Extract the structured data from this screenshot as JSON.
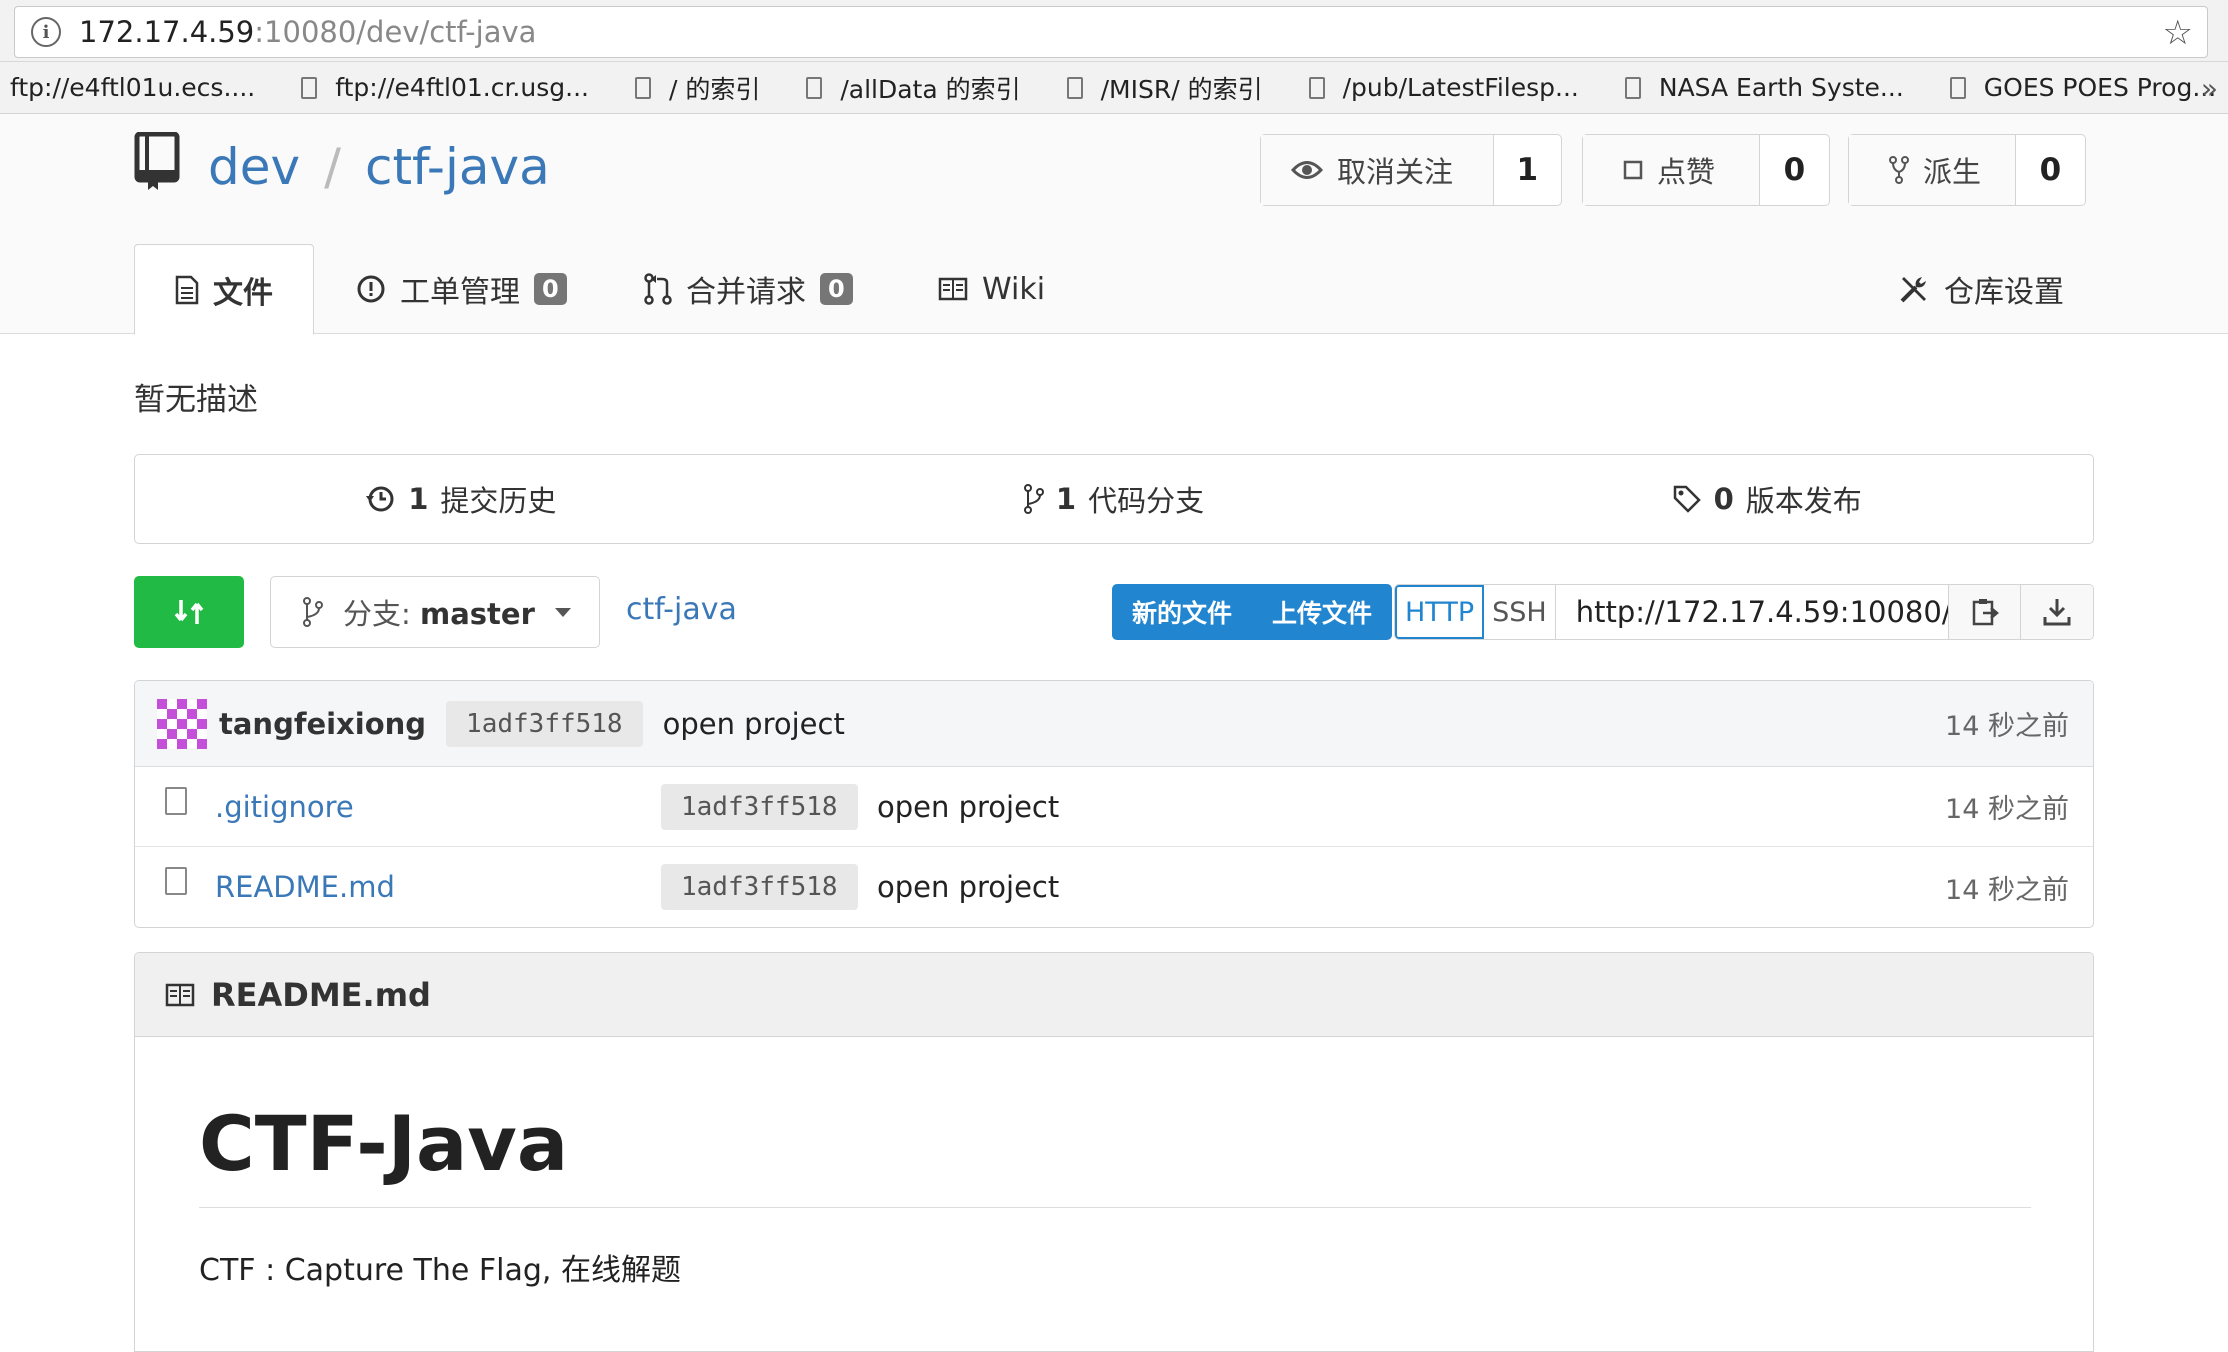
{
  "browser": {
    "url_host": "172.17.4.59",
    "url_rest": ":10080/dev/ctf-java",
    "bookmarks": [
      {
        "label": "ftp://e4ftl01u.ecs...."
      },
      {
        "label": "ftp://e4ftl01.cr.usg..."
      },
      {
        "label": "/ 的索引"
      },
      {
        "label": "/allData 的索引"
      },
      {
        "label": "/MISR/ 的索引"
      },
      {
        "label": "/pub/LatestFilesp..."
      },
      {
        "label": "NASA Earth Syste..."
      },
      {
        "label": "GOES POES Prog..."
      }
    ],
    "more": "»"
  },
  "repo": {
    "owner": "dev",
    "separator": "/",
    "name": "ctf-java",
    "watch": {
      "label": "取消关注",
      "count": "1"
    },
    "star": {
      "label": "点赞",
      "count": "0"
    },
    "fork": {
      "label": "派生",
      "count": "0"
    }
  },
  "tabs": {
    "files": "文件",
    "issues": {
      "label": "工单管理",
      "count": "0"
    },
    "pulls": {
      "label": "合并请求",
      "count": "0"
    },
    "wiki": "Wiki",
    "settings": "仓库设置"
  },
  "description": "暂无描述",
  "stats": {
    "commits": {
      "count": "1",
      "label": "提交历史"
    },
    "branches": {
      "count": "1",
      "label": "代码分支"
    },
    "releases": {
      "count": "0",
      "label": "版本发布"
    }
  },
  "toolbar": {
    "branch_prefix": "分支:",
    "branch": "master",
    "path": "ctf-java",
    "new_file": "新的文件",
    "upload_file": "上传文件",
    "http": "HTTP",
    "ssh": "SSH",
    "clone_url": "http://172.17.4.59:10080/"
  },
  "latest_commit": {
    "author": "tangfeixiong",
    "sha": "1adf3ff518",
    "message": "open project",
    "time": "14 秒之前"
  },
  "files": [
    {
      "name": ".gitignore",
      "sha": "1adf3ff518",
      "message": "open project",
      "time": "14 秒之前"
    },
    {
      "name": "README.md",
      "sha": "1adf3ff518",
      "message": "open project",
      "time": "14 秒之前"
    }
  ],
  "readme": {
    "filename": "README.md",
    "heading": "CTF-Java",
    "text": "CTF : Capture The Flag, 在线解题"
  },
  "colors": {
    "link": "#3b78b7",
    "primary": "#2185d0",
    "success": "#21ba45"
  }
}
